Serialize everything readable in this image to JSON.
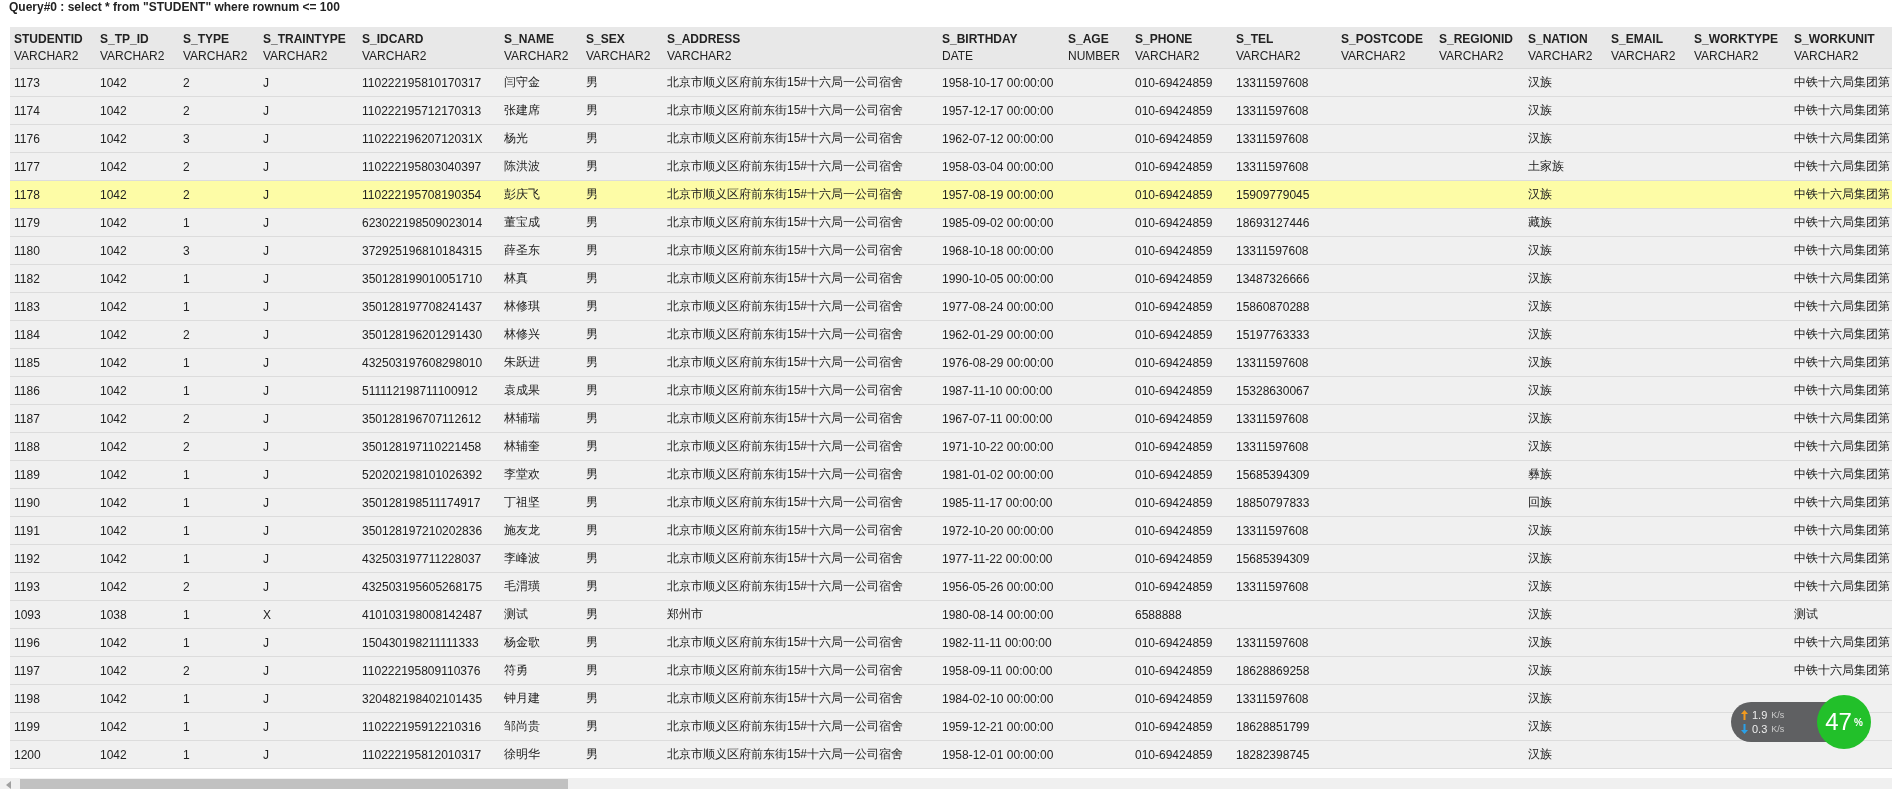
{
  "query": "Query#0 : select * from \"STUDENT\" where rownum <= 100",
  "columns": [
    {
      "name": "STUDENTID",
      "type": "VARCHAR2"
    },
    {
      "name": "S_TP_ID",
      "type": "VARCHAR2"
    },
    {
      "name": "S_TYPE",
      "type": "VARCHAR2"
    },
    {
      "name": "S_TRAINTYPE",
      "type": "VARCHAR2"
    },
    {
      "name": "S_IDCARD",
      "type": "VARCHAR2"
    },
    {
      "name": "S_NAME",
      "type": "VARCHAR2"
    },
    {
      "name": "S_SEX",
      "type": "VARCHAR2"
    },
    {
      "name": "S_ADDRESS",
      "type": "VARCHAR2"
    },
    {
      "name": "S_BIRTHDAY",
      "type": "DATE"
    },
    {
      "name": "S_AGE",
      "type": "NUMBER"
    },
    {
      "name": "S_PHONE",
      "type": "VARCHAR2"
    },
    {
      "name": "S_TEL",
      "type": "VARCHAR2"
    },
    {
      "name": "S_POSTCODE",
      "type": "VARCHAR2"
    },
    {
      "name": "S_REGIONID",
      "type": "VARCHAR2"
    },
    {
      "name": "S_NATION",
      "type": "VARCHAR2"
    },
    {
      "name": "S_EMAIL",
      "type": "VARCHAR2"
    },
    {
      "name": "S_WORKTYPE",
      "type": "VARCHAR2"
    },
    {
      "name": "S_WORKUNIT",
      "type": "VARCHAR2"
    }
  ],
  "rows": [
    {
      "selected": false,
      "cells": [
        "1173",
        "1042",
        "2",
        "J",
        "110222195810170317",
        "闫守金",
        "男",
        "北京市顺义区府前东街15#十六局一公司宿舍",
        "1958-10-17 00:00:00",
        null,
        "010-69424859",
        "13311597608",
        null,
        null,
        "汉族",
        null,
        null,
        "中铁十六局集团第"
      ]
    },
    {
      "selected": false,
      "cells": [
        "1174",
        "1042",
        "2",
        "J",
        "110222195712170313",
        "张建席",
        "男",
        "北京市顺义区府前东街15#十六局一公司宿舍",
        "1957-12-17 00:00:00",
        null,
        "010-69424859",
        "13311597608",
        null,
        null,
        "汉族",
        null,
        null,
        "中铁十六局集团第"
      ]
    },
    {
      "selected": false,
      "cells": [
        "1176",
        "1042",
        "3",
        "J",
        "11022219620712031X",
        "杨光",
        "男",
        "北京市顺义区府前东街15#十六局一公司宿舍",
        "1962-07-12 00:00:00",
        null,
        "010-69424859",
        "13311597608",
        null,
        null,
        "汉族",
        null,
        null,
        "中铁十六局集团第"
      ]
    },
    {
      "selected": false,
      "cells": [
        "1177",
        "1042",
        "2",
        "J",
        "110222195803040397",
        "陈洪波",
        "男",
        "北京市顺义区府前东街15#十六局一公司宿舍",
        "1958-03-04 00:00:00",
        null,
        "010-69424859",
        "13311597608",
        null,
        null,
        "土家族",
        null,
        null,
        "中铁十六局集团第"
      ]
    },
    {
      "selected": true,
      "cells": [
        "1178",
        "1042",
        "2",
        "J",
        "110222195708190354",
        "彭庆飞",
        "男",
        "北京市顺义区府前东街15#十六局一公司宿舍",
        "1957-08-19 00:00:00",
        null,
        "010-69424859",
        "15909779045",
        null,
        null,
        "汉族",
        null,
        null,
        "中铁十六局集团第"
      ]
    },
    {
      "selected": false,
      "cells": [
        "1179",
        "1042",
        "1",
        "J",
        "623022198509023014",
        "董宝成",
        "男",
        "北京市顺义区府前东街15#十六局一公司宿舍",
        "1985-09-02 00:00:00",
        null,
        "010-69424859",
        "18693127446",
        null,
        null,
        "藏族",
        null,
        null,
        "中铁十六局集团第"
      ]
    },
    {
      "selected": false,
      "cells": [
        "1180",
        "1042",
        "3",
        "J",
        "372925196810184315",
        "薛圣东",
        "男",
        "北京市顺义区府前东街15#十六局一公司宿舍",
        "1968-10-18 00:00:00",
        null,
        "010-69424859",
        "13311597608",
        null,
        null,
        "汉族",
        null,
        null,
        "中铁十六局集团第"
      ]
    },
    {
      "selected": false,
      "cells": [
        "1182",
        "1042",
        "1",
        "J",
        "350128199010051710",
        "林真",
        "男",
        "北京市顺义区府前东街15#十六局一公司宿舍",
        "1990-10-05 00:00:00",
        null,
        "010-69424859",
        "13487326666",
        null,
        null,
        "汉族",
        null,
        null,
        "中铁十六局集团第"
      ]
    },
    {
      "selected": false,
      "cells": [
        "1183",
        "1042",
        "1",
        "J",
        "350128197708241437",
        "林修琪",
        "男",
        "北京市顺义区府前东街15#十六局一公司宿舍",
        "1977-08-24 00:00:00",
        null,
        "010-69424859",
        "15860870288",
        null,
        null,
        "汉族",
        null,
        null,
        "中铁十六局集团第"
      ]
    },
    {
      "selected": false,
      "cells": [
        "1184",
        "1042",
        "2",
        "J",
        "350128196201291430",
        "林修兴",
        "男",
        "北京市顺义区府前东街15#十六局一公司宿舍",
        "1962-01-29 00:00:00",
        null,
        "010-69424859",
        "15197763333",
        null,
        null,
        "汉族",
        null,
        null,
        "中铁十六局集团第"
      ]
    },
    {
      "selected": false,
      "cells": [
        "1185",
        "1042",
        "1",
        "J",
        "432503197608298010",
        "朱跃进",
        "男",
        "北京市顺义区府前东街15#十六局一公司宿舍",
        "1976-08-29 00:00:00",
        null,
        "010-69424859",
        "13311597608",
        null,
        null,
        "汉族",
        null,
        null,
        "中铁十六局集团第"
      ]
    },
    {
      "selected": false,
      "cells": [
        "1186",
        "1042",
        "1",
        "J",
        "511112198711100912",
        "袁成果",
        "男",
        "北京市顺义区府前东街15#十六局一公司宿舍",
        "1987-11-10 00:00:00",
        null,
        "010-69424859",
        "15328630067",
        null,
        null,
        "汉族",
        null,
        null,
        "中铁十六局集团第"
      ]
    },
    {
      "selected": false,
      "cells": [
        "1187",
        "1042",
        "2",
        "J",
        "350128196707112612",
        "林辅瑞",
        "男",
        "北京市顺义区府前东街15#十六局一公司宿舍",
        "1967-07-11 00:00:00",
        null,
        "010-69424859",
        "13311597608",
        null,
        null,
        "汉族",
        null,
        null,
        "中铁十六局集团第"
      ]
    },
    {
      "selected": false,
      "cells": [
        "1188",
        "1042",
        "2",
        "J",
        "350128197110221458",
        "林辅奎",
        "男",
        "北京市顺义区府前东街15#十六局一公司宿舍",
        "1971-10-22 00:00:00",
        null,
        "010-69424859",
        "13311597608",
        null,
        null,
        "汉族",
        null,
        null,
        "中铁十六局集团第"
      ]
    },
    {
      "selected": false,
      "cells": [
        "1189",
        "1042",
        "1",
        "J",
        "520202198101026392",
        "李堂欢",
        "男",
        "北京市顺义区府前东街15#十六局一公司宿舍",
        "1981-01-02 00:00:00",
        null,
        "010-69424859",
        "15685394309",
        null,
        null,
        "彝族",
        null,
        null,
        "中铁十六局集团第"
      ]
    },
    {
      "selected": false,
      "cells": [
        "1190",
        "1042",
        "1",
        "J",
        "350128198511174917",
        "丁祖坚",
        "男",
        "北京市顺义区府前东街15#十六局一公司宿舍",
        "1985-11-17 00:00:00",
        null,
        "010-69424859",
        "18850797833",
        null,
        null,
        "回族",
        null,
        null,
        "中铁十六局集团第"
      ]
    },
    {
      "selected": false,
      "cells": [
        "1191",
        "1042",
        "1",
        "J",
        "350128197210202836",
        "施友龙",
        "男",
        "北京市顺义区府前东街15#十六局一公司宿舍",
        "1972-10-20 00:00:00",
        null,
        "010-69424859",
        "13311597608",
        null,
        null,
        "汉族",
        null,
        null,
        "中铁十六局集团第"
      ]
    },
    {
      "selected": false,
      "cells": [
        "1192",
        "1042",
        "1",
        "J",
        "432503197711228037",
        "李峰波",
        "男",
        "北京市顺义区府前东街15#十六局一公司宿舍",
        "1977-11-22 00:00:00",
        null,
        "010-69424859",
        "15685394309",
        null,
        null,
        "汉族",
        null,
        null,
        "中铁十六局集团第"
      ]
    },
    {
      "selected": false,
      "cells": [
        "1193",
        "1042",
        "2",
        "J",
        "432503195605268175",
        "毛渭璜",
        "男",
        "北京市顺义区府前东街15#十六局一公司宿舍",
        "1956-05-26 00:00:00",
        null,
        "010-69424859",
        "13311597608",
        null,
        null,
        "汉族",
        null,
        null,
        "中铁十六局集团第"
      ]
    },
    {
      "selected": false,
      "cells": [
        "1093",
        "1038",
        "1",
        "X",
        "410103198008142487",
        "测试",
        "男",
        "郑州市",
        "1980-08-14 00:00:00",
        null,
        "6588888",
        null,
        null,
        null,
        "汉族",
        null,
        null,
        "测试"
      ]
    },
    {
      "selected": false,
      "cells": [
        "1196",
        "1042",
        "1",
        "J",
        "150430198211111333",
        "杨金歌",
        "男",
        "北京市顺义区府前东街15#十六局一公司宿舍",
        "1982-11-11 00:00:00",
        null,
        "010-69424859",
        "13311597608",
        null,
        null,
        "汉族",
        null,
        null,
        "中铁十六局集团第"
      ]
    },
    {
      "selected": false,
      "cells": [
        "1197",
        "1042",
        "2",
        "J",
        "110222195809110376",
        "符勇",
        "男",
        "北京市顺义区府前东街15#十六局一公司宿舍",
        "1958-09-11 00:00:00",
        null,
        "010-69424859",
        "18628869258",
        null,
        null,
        "汉族",
        null,
        null,
        "中铁十六局集团第"
      ]
    },
    {
      "selected": false,
      "cells": [
        "1198",
        "1042",
        "1",
        "J",
        "320482198402101435",
        "钟月建",
        "男",
        "北京市顺义区府前东街15#十六局一公司宿舍",
        "1984-02-10 00:00:00",
        null,
        "010-69424859",
        "13311597608",
        null,
        null,
        "汉族",
        null,
        null,
        null
      ]
    },
    {
      "selected": false,
      "cells": [
        "1199",
        "1042",
        "1",
        "J",
        "110222195912210316",
        "邹尚贵",
        "男",
        "北京市顺义区府前东街15#十六局一公司宿舍",
        "1959-12-21 00:00:00",
        null,
        "010-69424859",
        "18628851799",
        null,
        null,
        "汉族",
        null,
        null,
        null
      ]
    },
    {
      "selected": false,
      "cells": [
        "1200",
        "1042",
        "1",
        "J",
        "110222195812010317",
        "徐明华",
        "男",
        "北京市顺义区府前东街15#十六局一公司宿舍",
        "1958-12-01 00:00:00",
        null,
        "010-69424859",
        "18282398745",
        null,
        null,
        "汉族",
        null,
        null,
        null
      ]
    }
  ],
  "net_widget": {
    "upload": "1.9",
    "download": "0.3",
    "unit_up": "K/s",
    "unit_down": "K/s",
    "percent": "47",
    "percent_sign": "%"
  }
}
